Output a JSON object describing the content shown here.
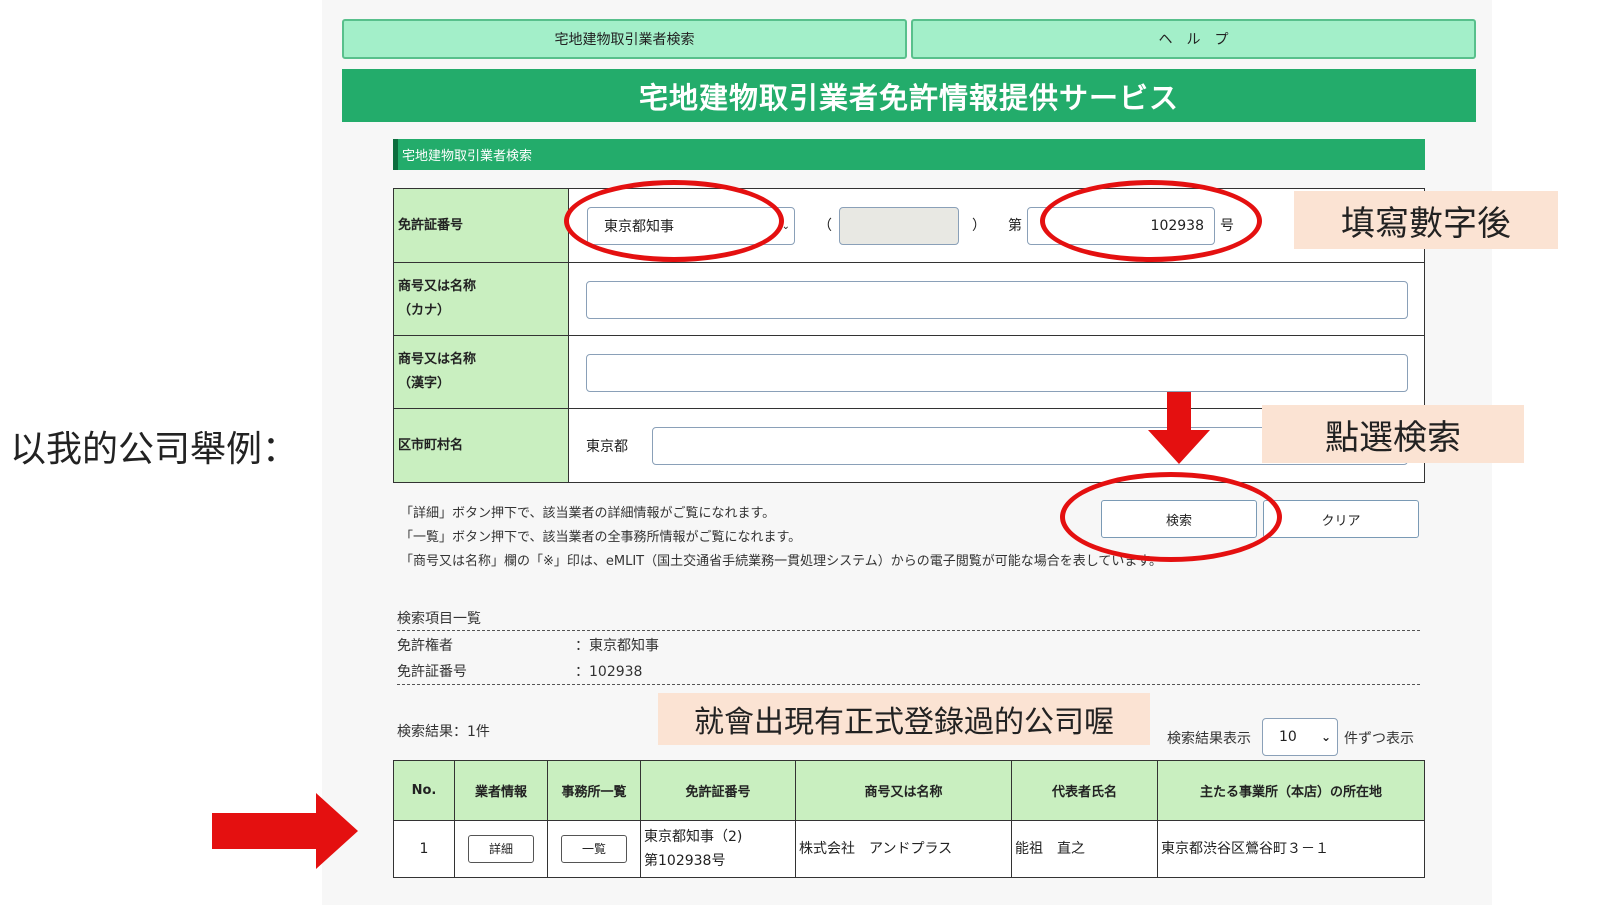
{
  "annotation": {
    "left_label": "以我的公司舉例：",
    "callout_fill": "填寫數字後",
    "callout_click": "點選検索",
    "callout_result": "就會出現有正式登錄過的公司喔",
    "accent_color": "#e41010"
  },
  "nav": {
    "search_tab": "宅地建物取引業者検索",
    "help_tab": "ヘ　ル　プ"
  },
  "banner": {
    "title": "宅地建物取引業者免許情報提供サービス"
  },
  "section": {
    "title": "宅地建物取引業者検索"
  },
  "form": {
    "license": {
      "label": "免許証番号",
      "authority": "東京都知事",
      "paren_open": "（",
      "paren_close": "）",
      "prefix": "第",
      "number": "102938",
      "suffix": "号"
    },
    "kana": {
      "label_1": "商号又は名称",
      "label_2": "（カナ）",
      "value": ""
    },
    "kanji": {
      "label_1": "商号又は名称",
      "label_2": "（漢字）",
      "value": ""
    },
    "city": {
      "label": "区市町村名",
      "prefecture": "東京都",
      "value": ""
    }
  },
  "buttons": {
    "search": "検索",
    "clear": "クリア"
  },
  "notes": [
    "「詳細」ボタン押下で、該当業者の詳細情報がご覧になれます。",
    "「一覧」ボタン押下で、該当業者の全事務所情報がご覧になれます。",
    "「商号又は名称」欄の「※」印は、eMLIT（国土交通省手続業務一貫処理システム）からの電子閲覧が可能な場合を表しています。"
  ],
  "criteria": {
    "heading": "検索項目一覧",
    "rows": [
      {
        "label": "免許権者",
        "value": "：東京都知事"
      },
      {
        "label": "免許証番号",
        "value": "：102938"
      }
    ]
  },
  "results": {
    "count": "検索結果：1件",
    "per_page_label": "検索結果表示",
    "per_page_value": "10",
    "per_page_suffix": "件ずつ表示",
    "headers": [
      "No.",
      "業者情報",
      "事務所一覧",
      "免許証番号",
      "商号又は名称",
      "代表者氏名",
      "主たる事業所（本店）の所在地"
    ],
    "row": {
      "no": "1",
      "detail_btn": "詳細",
      "list_btn": "一覧",
      "license_1": "東京都知事（2)",
      "license_2": "第102938号",
      "name": "株式会社　アンドプラス",
      "rep": "能祖　直之",
      "address": "東京都渋谷区鶯谷町３－１"
    }
  }
}
